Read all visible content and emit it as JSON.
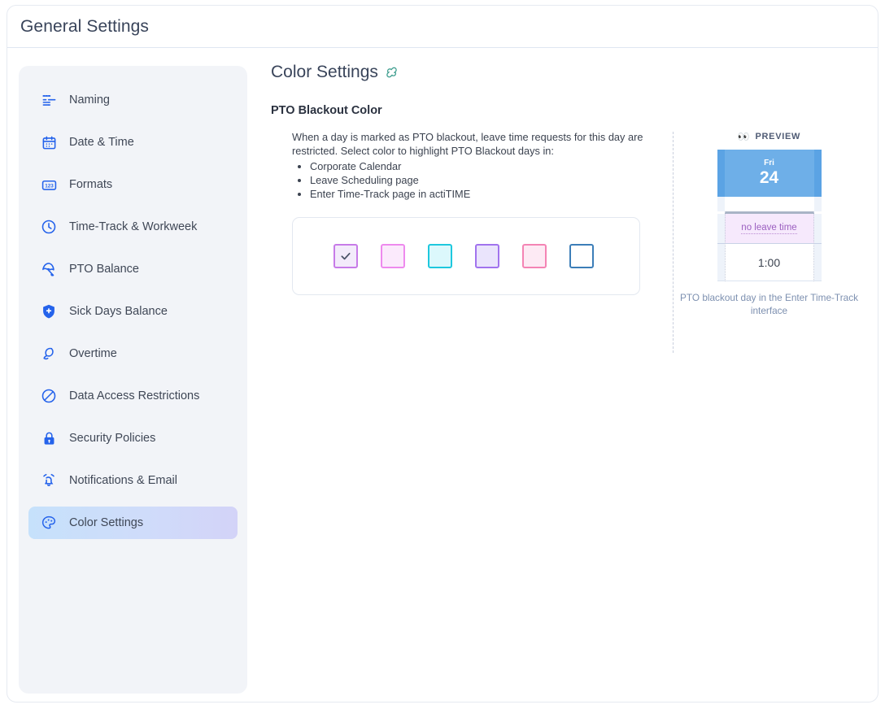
{
  "window": {
    "title": "General Settings"
  },
  "sidebar": {
    "items": [
      {
        "label": "Naming",
        "icon": "abc-list-icon",
        "active": false
      },
      {
        "label": "Date & Time",
        "icon": "calendar-icon",
        "active": false
      },
      {
        "label": "Formats",
        "icon": "number-format-icon",
        "active": false
      },
      {
        "label": "Time-Track & Workweek",
        "icon": "clock-icon",
        "active": false
      },
      {
        "label": "PTO Balance",
        "icon": "beach-umbrella-icon",
        "active": false
      },
      {
        "label": "Sick Days Balance",
        "icon": "shield-plus-icon",
        "active": false
      },
      {
        "label": "Overtime",
        "icon": "moon-icon",
        "active": false
      },
      {
        "label": "Data Access Restrictions",
        "icon": "no-entry-icon",
        "active": false
      },
      {
        "label": "Security Policies",
        "icon": "lock-icon",
        "active": false
      },
      {
        "label": "Notifications & Email",
        "icon": "bell-icon",
        "active": false
      },
      {
        "label": "Color Settings",
        "icon": "palette-icon",
        "active": true
      }
    ]
  },
  "content": {
    "title": "Color Settings",
    "link_icon": "link-icon",
    "section_title": "PTO Blackout Color",
    "description_paragraph": "When a day is marked as PTO blackout, leave time requests for this day are restricted. Select color to highlight PTO Blackout days in:",
    "description_bullets": [
      "Corporate Calendar",
      "Leave Scheduling page",
      "Enter Time-Track page in actiTIME"
    ],
    "swatches": [
      {
        "name": "swatch-light-purple",
        "fill": "#F3EBFB",
        "border": "#C77BE8",
        "selected": true
      },
      {
        "name": "swatch-light-magenta",
        "fill": "#FBEAFC",
        "border": "#EE8AEE",
        "selected": false
      },
      {
        "name": "swatch-cyan",
        "fill": "#DCF8FC",
        "border": "#1EC8DE",
        "selected": false
      },
      {
        "name": "swatch-lavender",
        "fill": "#EAE4FC",
        "border": "#A173EE",
        "selected": false
      },
      {
        "name": "swatch-pink",
        "fill": "#FDEAF4",
        "border": "#F484B4",
        "selected": false
      },
      {
        "name": "swatch-white",
        "fill": "#FFFFFF",
        "border": "#3C7EB8",
        "selected": false
      }
    ]
  },
  "preview": {
    "label": "PREVIEW",
    "eyes_icon": "👀",
    "day_of_week": "Fri",
    "day_number": "24",
    "band_text": "no leave time",
    "time_value": "1:00",
    "caption": "PTO blackout day in the Enter Time-Track interface",
    "header_color": "#6EAFE8",
    "band_color": "#F6E9FC",
    "band_text_color": "#9B5FC0"
  }
}
